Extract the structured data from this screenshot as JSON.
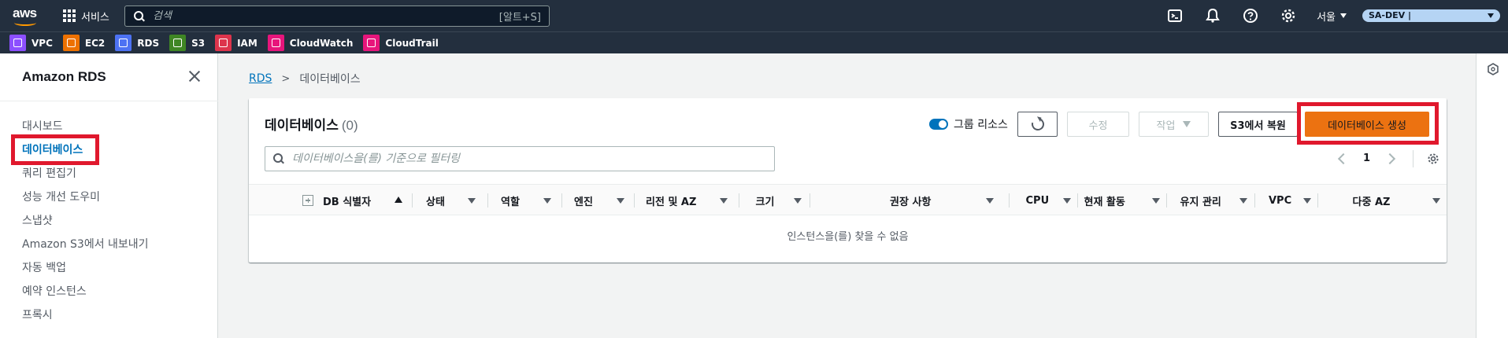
{
  "topbar": {
    "logo_text": "aws",
    "services_label": "서비스",
    "search_placeholder": "검색",
    "search_shortcut": "[알트+S]",
    "region_label": "서울",
    "account_label": "SA-DEV |"
  },
  "favorites": [
    {
      "label": "VPC",
      "color": "#8c4fff"
    },
    {
      "label": "EC2",
      "color": "#ed7100"
    },
    {
      "label": "RDS",
      "color": "#4d72f3"
    },
    {
      "label": "S3",
      "color": "#3f8624"
    },
    {
      "label": "IAM",
      "color": "#dd344c"
    },
    {
      "label": "CloudWatch",
      "color": "#e7157b"
    },
    {
      "label": "CloudTrail",
      "color": "#e7157b"
    }
  ],
  "sidebar": {
    "title": "Amazon RDS",
    "items": [
      {
        "label": "대시보드"
      },
      {
        "label": "데이터베이스",
        "active": true
      },
      {
        "label": "쿼리 편집기"
      },
      {
        "label": "성능 개선 도우미"
      },
      {
        "label": "스냅샷"
      },
      {
        "label": "Amazon S3에서 내보내기"
      },
      {
        "label": "자동 백업"
      },
      {
        "label": "예약 인스턴스"
      },
      {
        "label": "프록시"
      }
    ]
  },
  "breadcrumb": {
    "root": "RDS",
    "current": "데이터베이스"
  },
  "panel": {
    "title": "데이터베이스",
    "count": "(0)",
    "toggle_label": "그룹 리소스",
    "buttons": {
      "modify": "수정",
      "actions": "작업",
      "restore_s3": "S3에서 복원",
      "create": "데이터베이스 생성"
    },
    "filter_placeholder": "데이터베이스을(를) 기준으로 필터링",
    "page": "1",
    "columns": [
      "DB 식별자",
      "상태",
      "역할",
      "엔진",
      "리전 및 AZ",
      "크기",
      "권장 사항",
      "CPU",
      "현재 활동",
      "유지 관리",
      "VPC",
      "다중 AZ"
    ],
    "empty_message": "인스턴스을(를) 찾을 수 없음"
  },
  "colors": {
    "primary_button": "#ec7211",
    "highlight": "#e0182d",
    "link": "#0073bb",
    "nav_bg": "#232f3e"
  }
}
